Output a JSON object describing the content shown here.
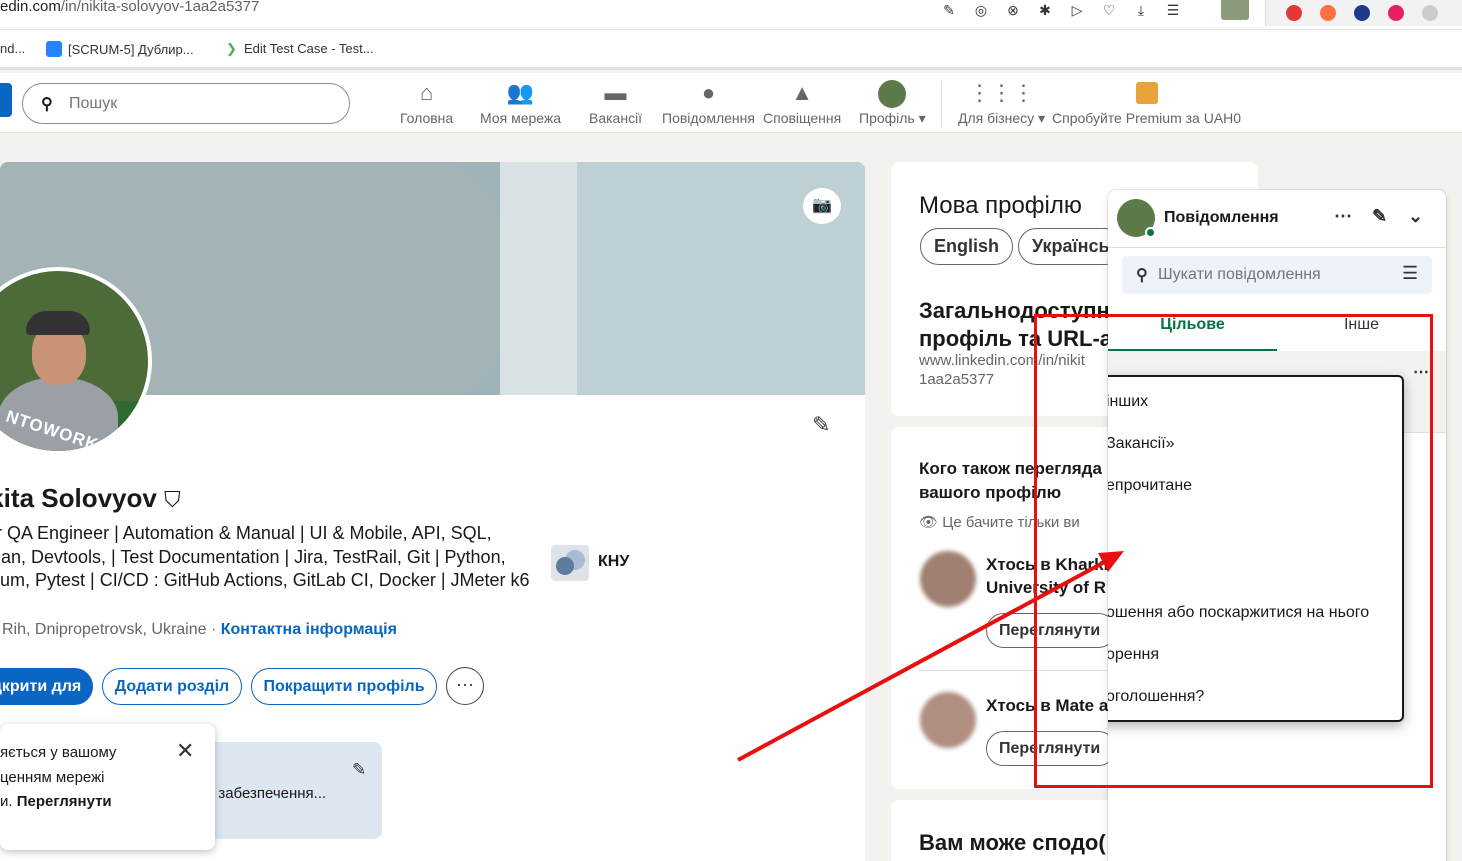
{
  "browser": {
    "url_host": "edin.com",
    "url_path": "/in/nikita-solovyov-1aa2a5377",
    "bookmarks": [
      {
        "label": "nd..."
      },
      {
        "label": "[SCRUM-5] Дублир..."
      },
      {
        "label": "Edit Test Case - Test..."
      }
    ]
  },
  "nav": {
    "search_placeholder": "Пошук",
    "items": [
      {
        "label": "Головна",
        "icon": "home-icon"
      },
      {
        "label": "Моя мережа",
        "icon": "network-icon"
      },
      {
        "label": "Вакансії",
        "icon": "briefcase-icon"
      },
      {
        "label": "Повідомлення",
        "icon": "messaging-icon"
      },
      {
        "label": "Сповіщення",
        "icon": "bell-icon"
      },
      {
        "label": "Профіль",
        "icon": "profile-avatar"
      },
      {
        "label": "Для бізнесу",
        "icon": "grid-icon"
      },
      {
        "label": "Спробуйте Premium за UAH0",
        "icon": "premium-icon"
      }
    ]
  },
  "profile": {
    "photo_badge": "NTOWORK",
    "name": "ikita Solovyov",
    "headline": "or QA Engineer | Automation & Manual | UI & Mobile, API, SQL, man, Devtools, | Test Documentation | Jira, TestRail, Git |  Python, nium, Pytest  | CI/CD : GitHub Actions, GitLab CI, Docker | JMeter k6",
    "location": "vi Rih, Dnipropetrovsk, Ukraine",
    "contact_info": "Контактна інформація",
    "education": "КНУ",
    "buttons": {
      "open_to": "дкрити для",
      "add_section": "Додати розділ",
      "improve": "Покращити профіль"
    },
    "open_to_card_text": "ї забезпечення...",
    "popup_line1": "яється у вашому",
    "popup_line2": "ценням мережі",
    "popup_line3_prefix": "и.",
    "popup_line3_link": "Переглянути"
  },
  "right": {
    "lang_title": "Мова профілю",
    "lang_options": [
      "English",
      "Українсь"
    ],
    "public_title": "Загальнодоступни профіль та URL-а",
    "public_url": "www.linkedin.com/in/nikit 1aa2a5377",
    "who_title": "Кого також перегляда вашого профілю",
    "who_note": "Це бачите тільки ви",
    "people": [
      {
        "name": "Хтось в Kharki University of R",
        "button": "Переглянути"
      },
      {
        "name": "Хтось в Mate a",
        "button": "Переглянути"
      }
    ],
    "may_like_title": "Вам може сподо("
  },
  "messaging": {
    "title": "Повідомлення",
    "search_placeholder": "Шукати повідомлення",
    "tabs": [
      {
        "label": "Цільове",
        "active": true
      },
      {
        "label": "Інше",
        "active": false
      }
    ],
    "context_menu": [
      "інших",
      "Закансії»",
      "епрочитане",
      "ошення або поскаржитися на нього",
      "орення",
      "оголошення?"
    ]
  },
  "annotation": {
    "color": "#e8100e"
  }
}
